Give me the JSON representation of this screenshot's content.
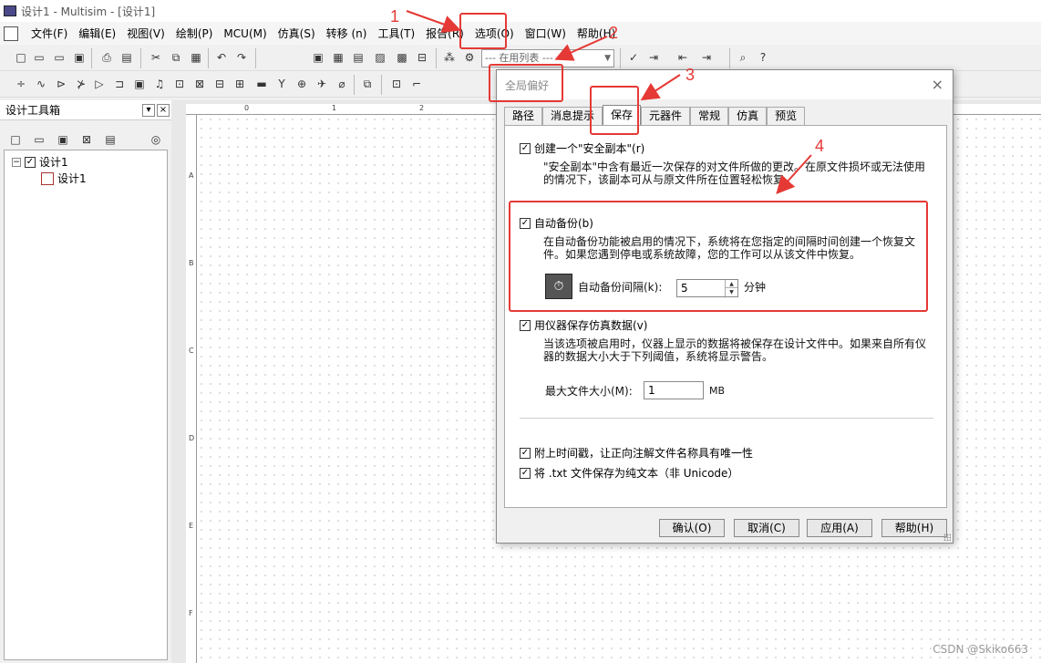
{
  "window": {
    "title": "设计1 - Multisim - [设计1]"
  },
  "menu": [
    "文件(F)",
    "编辑(E)",
    "视图(V)",
    "绘制(P)",
    "MCU(M)",
    "仿真(S)",
    "转移 (n)",
    "工具(T)",
    "报告(R)",
    "选项(O)",
    "窗口(W)",
    "帮助(H)"
  ],
  "toolbar": {
    "inuse_list": "--- 在用列表 ---"
  },
  "sidebar": {
    "title": "设计工具箱",
    "pin": "▾",
    "close": "×",
    "tree": {
      "root": "设计1",
      "child": "设计1"
    }
  },
  "canvas": {
    "ruler_top": [
      "0",
      "1",
      "2"
    ],
    "ruler_left": [
      "A",
      "B",
      "C",
      "D",
      "E",
      "F"
    ]
  },
  "dialog": {
    "title": "全局偏好",
    "close": "×",
    "tabs": [
      "路径",
      "消息提示",
      "保存",
      "元器件",
      "常规",
      "仿真",
      "预览"
    ],
    "active_tab": "保存",
    "options": {
      "safety_copy": {
        "label": "创建一个\"安全副本\"(r)",
        "checked": true,
        "desc": "\"安全副本\"中含有最近一次保存的对文件所做的更改。在原文件损坏或无法使用的情况下，该副本可从与原文件所在位置轻松恢复。"
      },
      "auto_backup": {
        "label": "自动备份(b)",
        "checked": true,
        "desc": "在自动备份功能被启用的情况下，系统将在您指定的间隔时间创建一个恢复文件。如果您遇到停电或系统故障，您的工作可以从该文件中恢复。",
        "interval_label": "自动备份间隔(k):",
        "interval_value": "5",
        "interval_unit": "分钟"
      },
      "instrument_data": {
        "label": "用仪器保存仿真数据(v)",
        "checked": true,
        "desc": "当该选项被启用时，仪器上显示的数据将被保存在设计文件中。如果来自所有仪器的数据大小大于下列阈值，系统将显示警告。",
        "max_size_label": "最大文件大小(M):",
        "max_size_value": "1",
        "max_size_unit": "MB"
      },
      "timestamp": {
        "label": "附上时间戳，让正向注解文件名称具有唯一性",
        "checked": true
      },
      "txt_plain": {
        "label": "将 .txt 文件保存为纯文本（非 Unicode）",
        "checked": true
      }
    },
    "buttons": {
      "ok": "确认(O)",
      "cancel": "取消(C)",
      "apply": "应用(A)",
      "help": "帮助(H)"
    }
  },
  "annotations": {
    "n1": "1",
    "n2": "2",
    "n3": "3",
    "n4": "4",
    "color": "#e53935"
  },
  "watermark": "CSDN @Skiko663"
}
